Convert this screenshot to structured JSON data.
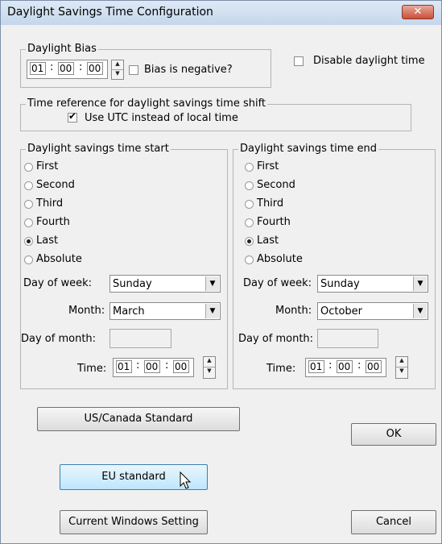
{
  "window": {
    "title": "Daylight Savings Time Configuration",
    "close_glyph": "✕"
  },
  "bias": {
    "legend": "Daylight Bias",
    "hours": "01",
    "minutes": "00",
    "seconds": "00",
    "negative_label": "Bias is negative?",
    "negative_checked": false
  },
  "disable": {
    "label": "Disable daylight time",
    "checked": false
  },
  "reference": {
    "legend": "Time reference for daylight savings time shift",
    "utc_label": "Use UTC instead of local time",
    "utc_checked": true
  },
  "start": {
    "legend": "Daylight savings time start",
    "options": [
      "First",
      "Second",
      "Third",
      "Fourth",
      "Last",
      "Absolute"
    ],
    "selected": "Last",
    "day_of_week_label": "Day of week:",
    "day_of_week": "Sunday",
    "month_label": "Month:",
    "month": "March",
    "day_of_month_label": "Day of month:",
    "day_of_month": "",
    "time_label": "Time:",
    "time_h": "01",
    "time_m": "00",
    "time_s": "00"
  },
  "end": {
    "legend": "Daylight savings time end",
    "options": [
      "First",
      "Second",
      "Third",
      "Fourth",
      "Last",
      "Absolute"
    ],
    "selected": "Last",
    "day_of_week_label": "Day of week:",
    "day_of_week": "Sunday",
    "month_label": "Month:",
    "month": "October",
    "day_of_month_label": "Day of month:",
    "day_of_month": "",
    "time_label": "Time:",
    "time_h": "01",
    "time_m": "00",
    "time_s": "00"
  },
  "buttons": {
    "us_canada": "US/Canada Standard",
    "ok": "OK",
    "eu": "EU standard",
    "current_windows": "Current Windows Setting",
    "cancel": "Cancel"
  },
  "colon": ":"
}
